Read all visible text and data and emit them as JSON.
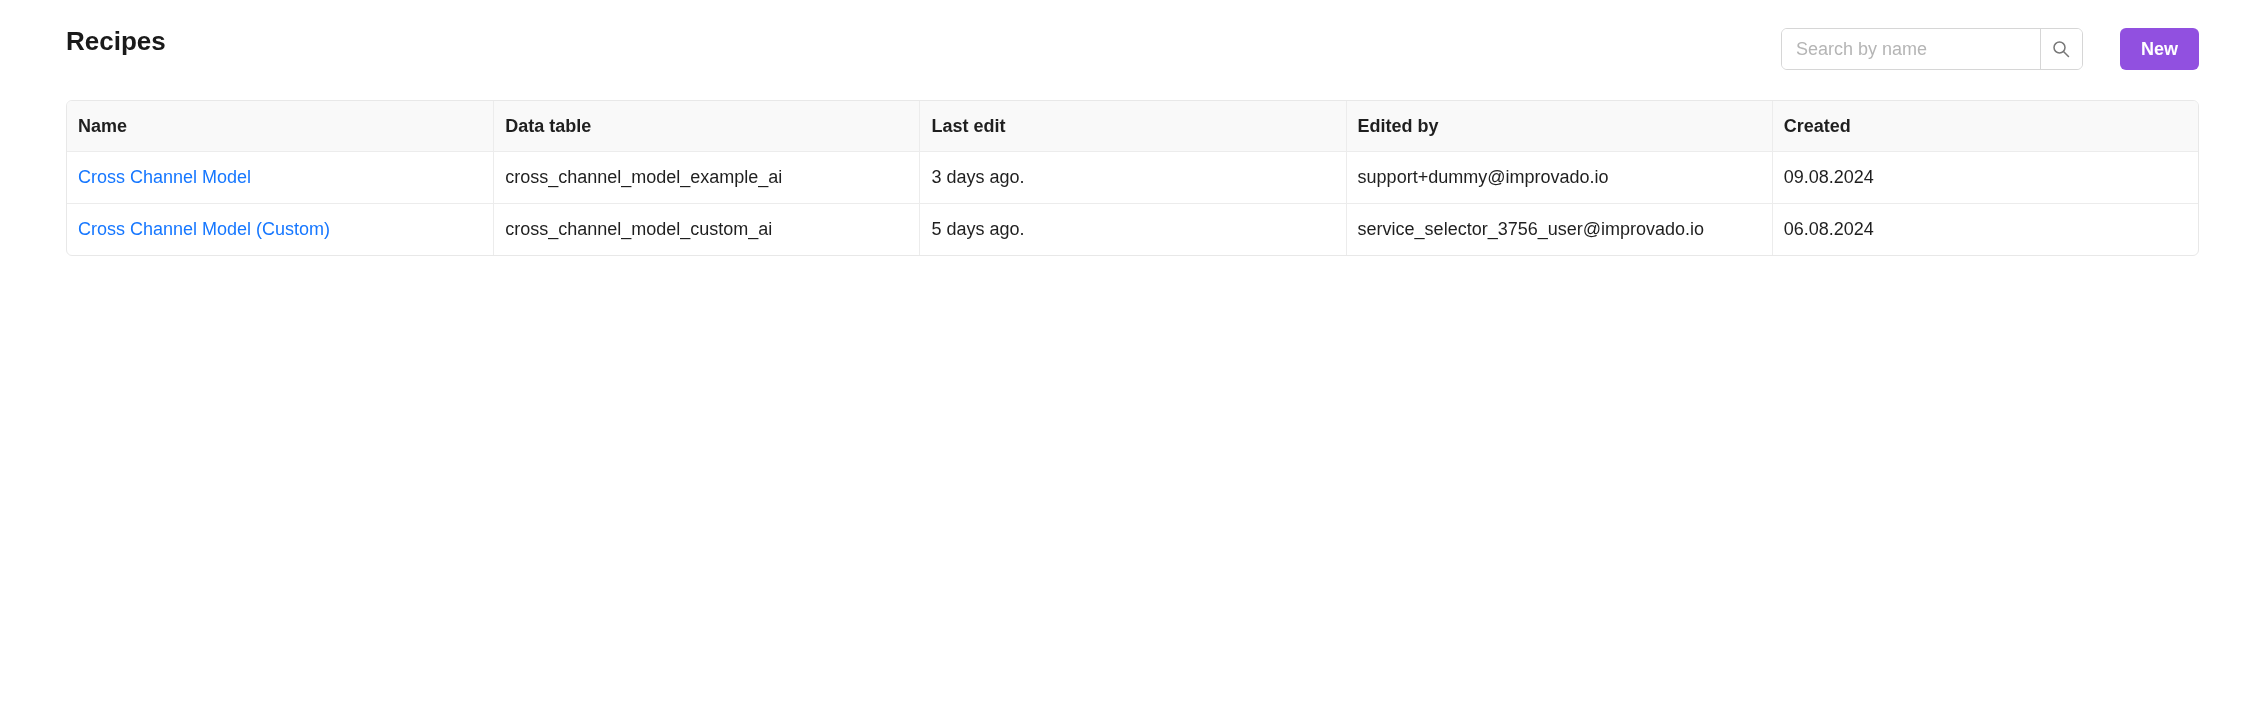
{
  "page": {
    "title": "Recipes"
  },
  "search": {
    "placeholder": "Search by name"
  },
  "new_button": {
    "label": "New"
  },
  "table": {
    "columns": [
      "Name",
      "Data table",
      "Last edit",
      "Edited by",
      "Created"
    ],
    "rows": [
      {
        "name": "Cross Channel Model",
        "data_table": "cross_channel_model_example_ai",
        "last_edit": "3 days ago.",
        "edited_by": "support+dummy@improvado.io",
        "created": "09.08.2024"
      },
      {
        "name": "Cross Channel Model (Custom)",
        "data_table": "cross_channel_model_custom_ai",
        "last_edit": "5 days ago.",
        "edited_by": "service_selector_3756_user@improvado.io",
        "created": "06.08.2024"
      }
    ]
  }
}
